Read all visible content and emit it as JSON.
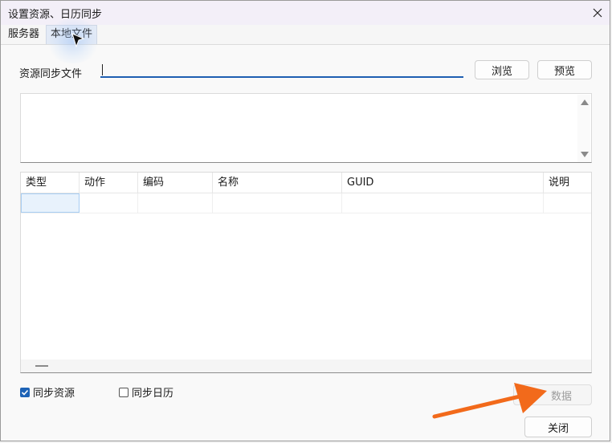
{
  "window": {
    "title": "设置资源、日历同步"
  },
  "tabs": [
    {
      "label": "服务器"
    },
    {
      "label": "本地文件"
    }
  ],
  "file_sync": {
    "label": "资源同步文件",
    "value": "",
    "browse_label": "浏览",
    "preview_label": "预览"
  },
  "table": {
    "columns": [
      "类型",
      "动作",
      "编码",
      "名称",
      "GUID",
      "说明"
    ],
    "rows": [
      [
        "",
        "",
        "",
        "",
        "",
        ""
      ]
    ]
  },
  "options": {
    "sync_resources_label": "同步资源",
    "sync_resources_checked": true,
    "sync_calendar_label": "同步日历",
    "sync_calendar_checked": false
  },
  "buttons": {
    "data_label": "数据",
    "close_label": "关闭"
  },
  "colors": {
    "accent": "#1e63b6",
    "arrow": "#f26a1b"
  }
}
